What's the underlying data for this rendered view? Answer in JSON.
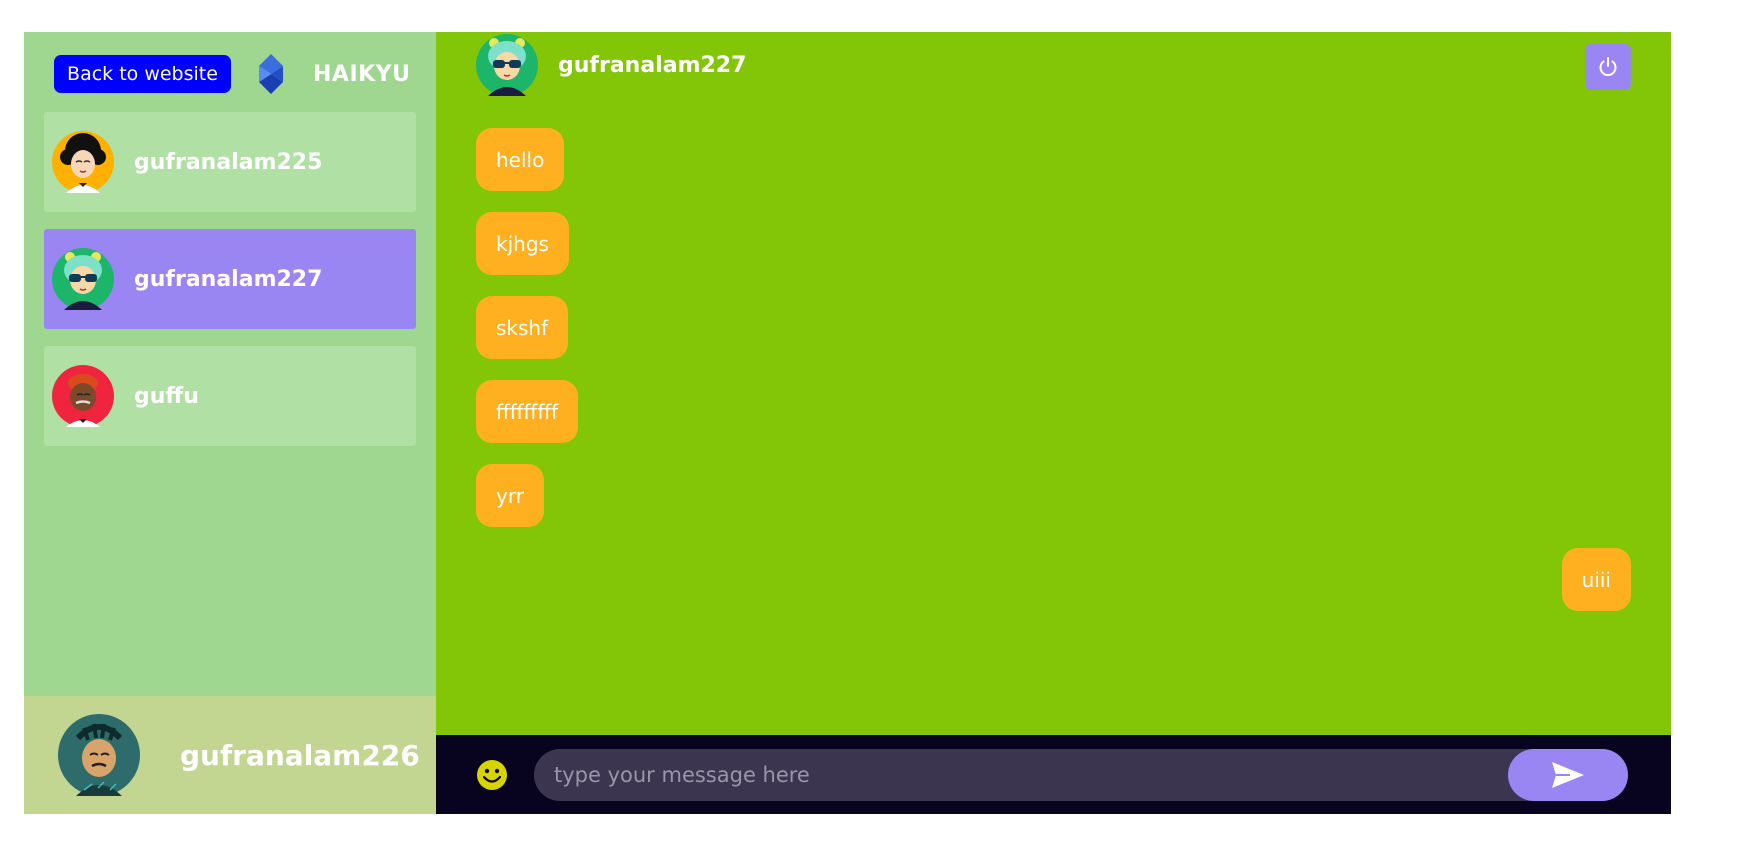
{
  "sidebar": {
    "back_label": "Back to website",
    "brand_name": "HAIKYU",
    "contacts": [
      {
        "name": "gufranalam225",
        "selected": false,
        "avatar": "avatar-afro-icon"
      },
      {
        "name": "gufranalam227",
        "selected": true,
        "avatar": "avatar-sunglasses-icon"
      },
      {
        "name": "guffu",
        "selected": false,
        "avatar": "avatar-bearded-icon"
      }
    ],
    "current_user": {
      "name": "gufranalam226",
      "avatar": "avatar-dreadlocks-icon"
    }
  },
  "chat": {
    "header_name": "gufranalam227",
    "messages": [
      {
        "text": "hello",
        "direction": "received"
      },
      {
        "text": "kjhgs",
        "direction": "received"
      },
      {
        "text": "skshf",
        "direction": "received"
      },
      {
        "text": "fffffffff",
        "direction": "received"
      },
      {
        "text": "yrr",
        "direction": "received"
      },
      {
        "text": "uiii",
        "direction": "sent"
      }
    ],
    "input_placeholder": "type your message here",
    "input_value": ""
  },
  "colors": {
    "sidebar_bg": "#9fd791",
    "contact_bg": "#b1e0a4",
    "selected_bg": "#9a86f3",
    "chat_bg": "#82c607",
    "bubble_bg": "#ffb021",
    "composer_bg": "#080420",
    "back_button_bg": "#0000ff"
  }
}
